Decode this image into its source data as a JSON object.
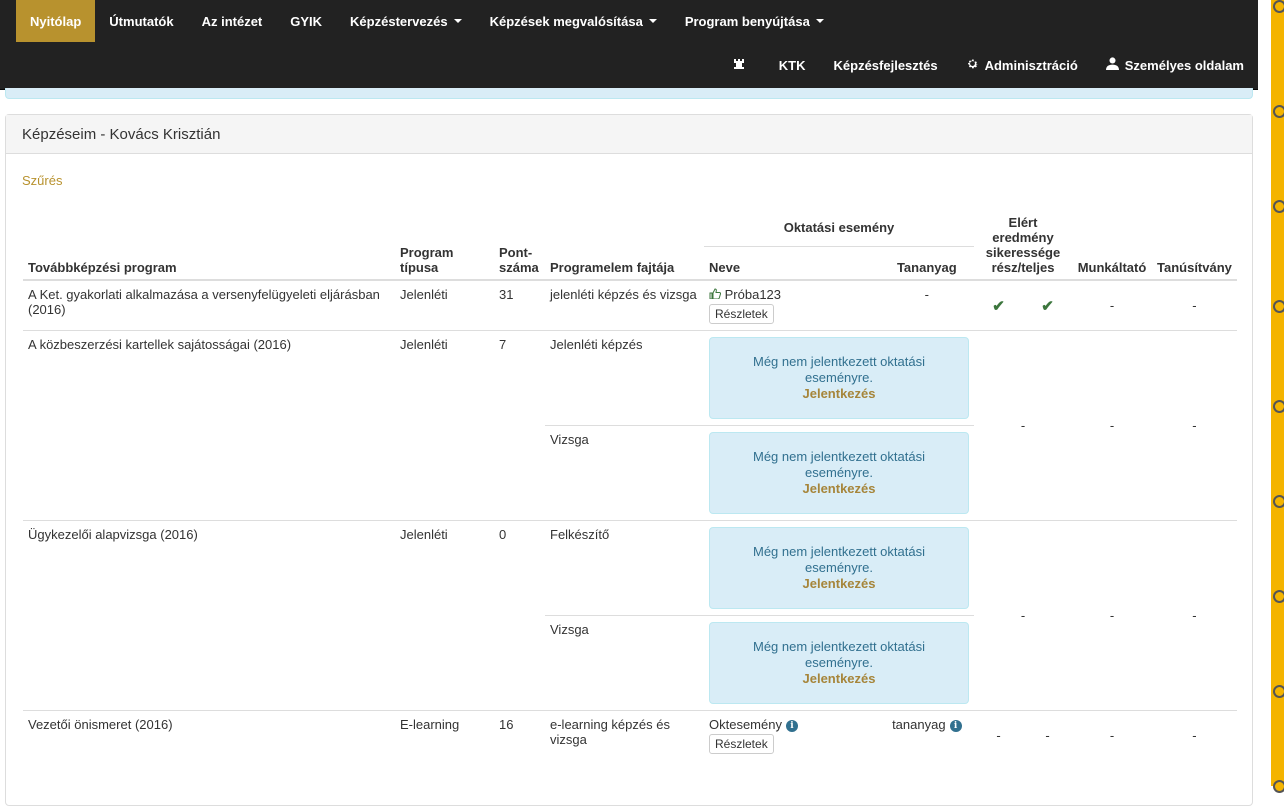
{
  "nav": {
    "primary": [
      {
        "label": "Nyitólap",
        "active": true,
        "dropdown": false
      },
      {
        "label": "Útmutatók",
        "active": false,
        "dropdown": false
      },
      {
        "label": "Az intézet",
        "active": false,
        "dropdown": false
      },
      {
        "label": "GYIK",
        "active": false,
        "dropdown": false
      },
      {
        "label": "Képzéstervezés",
        "active": false,
        "dropdown": true
      },
      {
        "label": "Képzések megvalósítása",
        "active": false,
        "dropdown": true
      },
      {
        "label": "Program benyújtása",
        "active": false,
        "dropdown": true
      }
    ],
    "secondary": [
      {
        "label": "",
        "icon": "rook-icon"
      },
      {
        "label": "KTK",
        "icon": ""
      },
      {
        "label": "Képzésfejlesztés",
        "icon": ""
      },
      {
        "label": "Adminisztráció",
        "icon": "gear-icon"
      },
      {
        "label": "Személyes oldalam",
        "icon": "user-icon"
      }
    ]
  },
  "panel": {
    "title": "Képzéseim - Kovács Krisztián",
    "filter_label": "Szűrés"
  },
  "table": {
    "headers": {
      "program": "Továbbképzési program",
      "type": "Program típusa",
      "points": "Pont-száma",
      "element": "Programelem fajtája",
      "event_group": "Oktatási esemény",
      "event_name": "Neve",
      "material": "Tananyag",
      "result": "Elért eredmény sikeressége rész/teljes",
      "employer": "Munkáltató",
      "certificate": "Tanúsítvány"
    },
    "rows": [
      {
        "program": "A Ket. gyakorlati alkalmazása a versenyfelügyeleti eljárásban (2016)",
        "type": "Jelenléti",
        "points": "31",
        "element": "jelenléti képzés és vizsga",
        "event_name": "Próba123",
        "details_button": "Részletek",
        "material": "-",
        "result_part": "✔",
        "result_full": "✔",
        "employer": "-",
        "certificate": "-"
      },
      {
        "program": "A közbeszerzési kartellek sajátosságai (2016)",
        "type": "Jelenléti",
        "points": "7",
        "elements": [
          {
            "element": "Jelenléti képzés",
            "alert_text": "Még nem jelentkezett oktatási eseményre.",
            "alert_link": "Jelentkezés"
          },
          {
            "element": "Vizsga",
            "alert_text": "Még nem jelentkezett oktatási eseményre.",
            "alert_link": "Jelentkezés"
          }
        ],
        "result": "-",
        "employer": "-",
        "certificate": "-"
      },
      {
        "program": "Ügykezelői alapvizsga (2016)",
        "type": "Jelenléti",
        "points": "0",
        "elements": [
          {
            "element": "Felkészítő",
            "alert_text": "Még nem jelentkezett oktatási eseményre.",
            "alert_link": "Jelentkezés"
          },
          {
            "element": "Vizsga",
            "alert_text": "Még nem jelentkezett oktatási eseményre.",
            "alert_link": "Jelentkezés"
          }
        ],
        "result": "-",
        "employer": "-",
        "certificate": "-"
      },
      {
        "program": "Vezetői önismeret (2016)",
        "type": "E-learning",
        "points": "16",
        "element": "e-learning képzés és vizsga",
        "event_name": "Oktesemény",
        "details_button": "Részletek",
        "material": "tananyag",
        "result_part": "-",
        "result_full": "-",
        "employer": "-",
        "certificate": "-"
      }
    ]
  },
  "colors": {
    "navbar_bg": "#222222",
    "active_nav": "#b8922e",
    "alert_bg": "#d9edf7",
    "alert_text": "#31708f",
    "link_gold": "#a6853a",
    "check_green": "#3c763d",
    "side_accent": "#f4b400"
  }
}
